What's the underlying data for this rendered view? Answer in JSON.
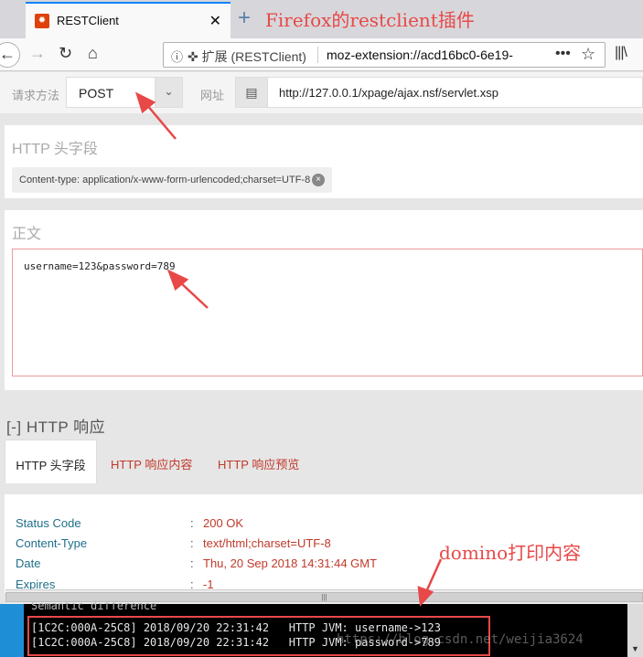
{
  "browser": {
    "tab_title": "RESTClient",
    "tab_close": "✕",
    "new_tab": "+",
    "favicon_glyph": "✹",
    "url_ext_label": "扩展 (RESTClient)",
    "url_text": "moz-extension://acd16bc0-6e19-",
    "more_glyph": "•••",
    "star_glyph": "☆",
    "library_glyph": "|||\\"
  },
  "annotations": {
    "top": "Firefox的restclient插件",
    "domino": "domino打印内容"
  },
  "request": {
    "method_label": "请求方法",
    "method_value": "POST",
    "url_label": "网址",
    "url_value": "http://127.0.0.1/xpage/ajax.nsf/servlet.xsp"
  },
  "headers": {
    "title": "HTTP 头字段",
    "chip": "Content-type: application/x-www-form-urlencoded;charset=UTF-8"
  },
  "body": {
    "title": "正文",
    "value": "username=123&password=789"
  },
  "response": {
    "title": "[-] HTTP 响应",
    "tabs": [
      "HTTP 头字段",
      "HTTP 响应内容",
      "HTTP 响应预览"
    ],
    "rows": [
      {
        "key": "Status Code",
        "value": "200 OK"
      },
      {
        "key": "Content-Type",
        "value": "text/html;charset=UTF-8"
      },
      {
        "key": "Date",
        "value": "Thu, 20 Sep 2018 14:31:44 GMT"
      },
      {
        "key": "Expires",
        "value": "-1"
      }
    ]
  },
  "console": {
    "partial_line": "Semantic difference",
    "lines": [
      "[1C2C:000A-25C8] 2018/09/20 22:31:42   HTTP JVM: username->123",
      "[1C2C:000A-25C8] 2018/09/20 22:31:42   HTTP JVM: password->789"
    ],
    "watermark": "https://blog.csdn.net/weijia3624"
  },
  "colors": {
    "annotation": "#e84848",
    "accent_tab": "#0a84ff",
    "response_value": "#c0392b",
    "response_key": "#1f6f8b"
  }
}
